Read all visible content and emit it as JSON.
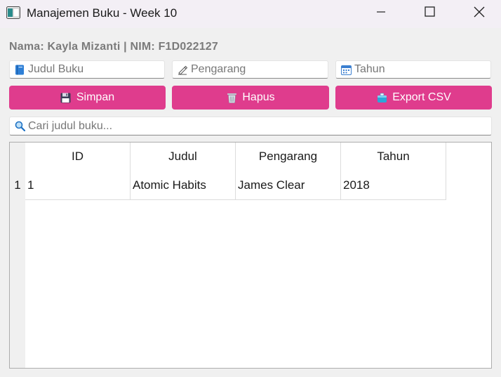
{
  "window": {
    "title": "Manajemen Buku - Week 10"
  },
  "student_info": "Nama: Kayla Mizanti | NIM: F1D022127",
  "inputs": {
    "judul": {
      "placeholder": "Judul Buku",
      "value": "",
      "icon": "book-icon"
    },
    "pengarang": {
      "placeholder": "Pengarang",
      "value": "",
      "icon": "writing-hand-icon"
    },
    "tahun": {
      "placeholder": "Tahun",
      "value": "",
      "icon": "calendar-icon"
    },
    "search": {
      "placeholder": "Cari judul buku...",
      "value": "",
      "icon": "magnifier-icon"
    }
  },
  "buttons": {
    "simpan": {
      "label": "Simpan",
      "icon": "floppy-disk-icon"
    },
    "hapus": {
      "label": "Hapus",
      "icon": "trash-icon"
    },
    "export": {
      "label": "Export CSV",
      "icon": "package-icon"
    }
  },
  "table": {
    "columns": [
      "ID",
      "Judul",
      "Pengarang",
      "Tahun"
    ],
    "rows": [
      {
        "row_number": "1",
        "cells": [
          "1",
          "Atomic Habits",
          "James Clear",
          "2018"
        ]
      }
    ]
  },
  "colors": {
    "accent": "#df3c8d",
    "titlebar": "#f3eff5",
    "background": "#f0f0f0"
  }
}
